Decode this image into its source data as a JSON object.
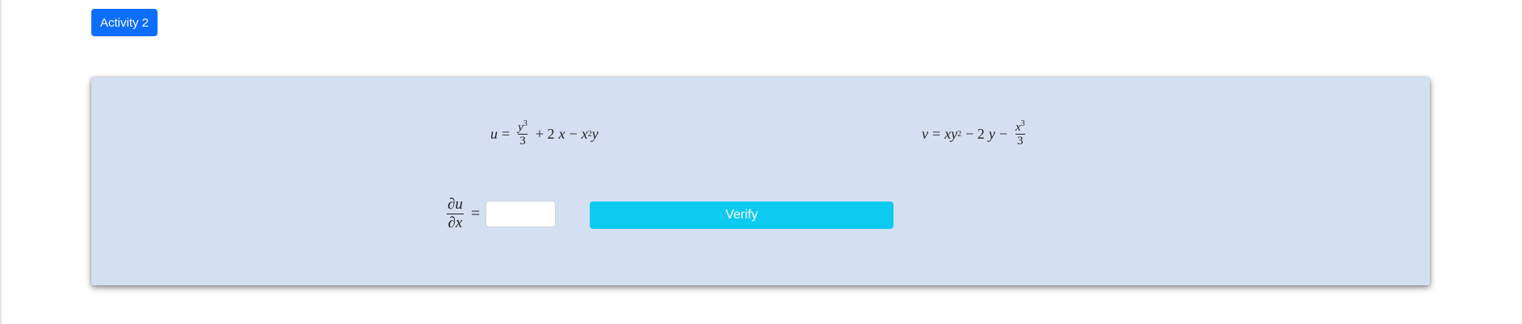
{
  "header": {
    "activity_label": "Activity 2"
  },
  "equations": {
    "u": {
      "lhs": "u",
      "eq": "=",
      "frac_num": "y",
      "frac_num_exp": "3",
      "frac_den": "3",
      "t1": "+ 2",
      "t1_var": "x",
      "t2": "−",
      "t2_var": "x",
      "t2_exp": "2",
      "t2_var2": "y"
    },
    "v": {
      "lhs": "v",
      "eq": "=",
      "t1_var": "x",
      "t1_var2": "y",
      "t1_exp": "2",
      "t2": "− 2",
      "t2_var": "y",
      "t3": "−",
      "frac_num": "x",
      "frac_num_exp": "3",
      "frac_den": "3"
    }
  },
  "question": {
    "num": "∂u",
    "den": "∂x",
    "eq": "="
  },
  "answer_input": {
    "value": "",
    "placeholder": ""
  },
  "verify": {
    "label": "Verify"
  },
  "colors": {
    "primary": "#0d6efd",
    "info": "#0dcaf0",
    "card_bg": "#d4e0f1"
  }
}
